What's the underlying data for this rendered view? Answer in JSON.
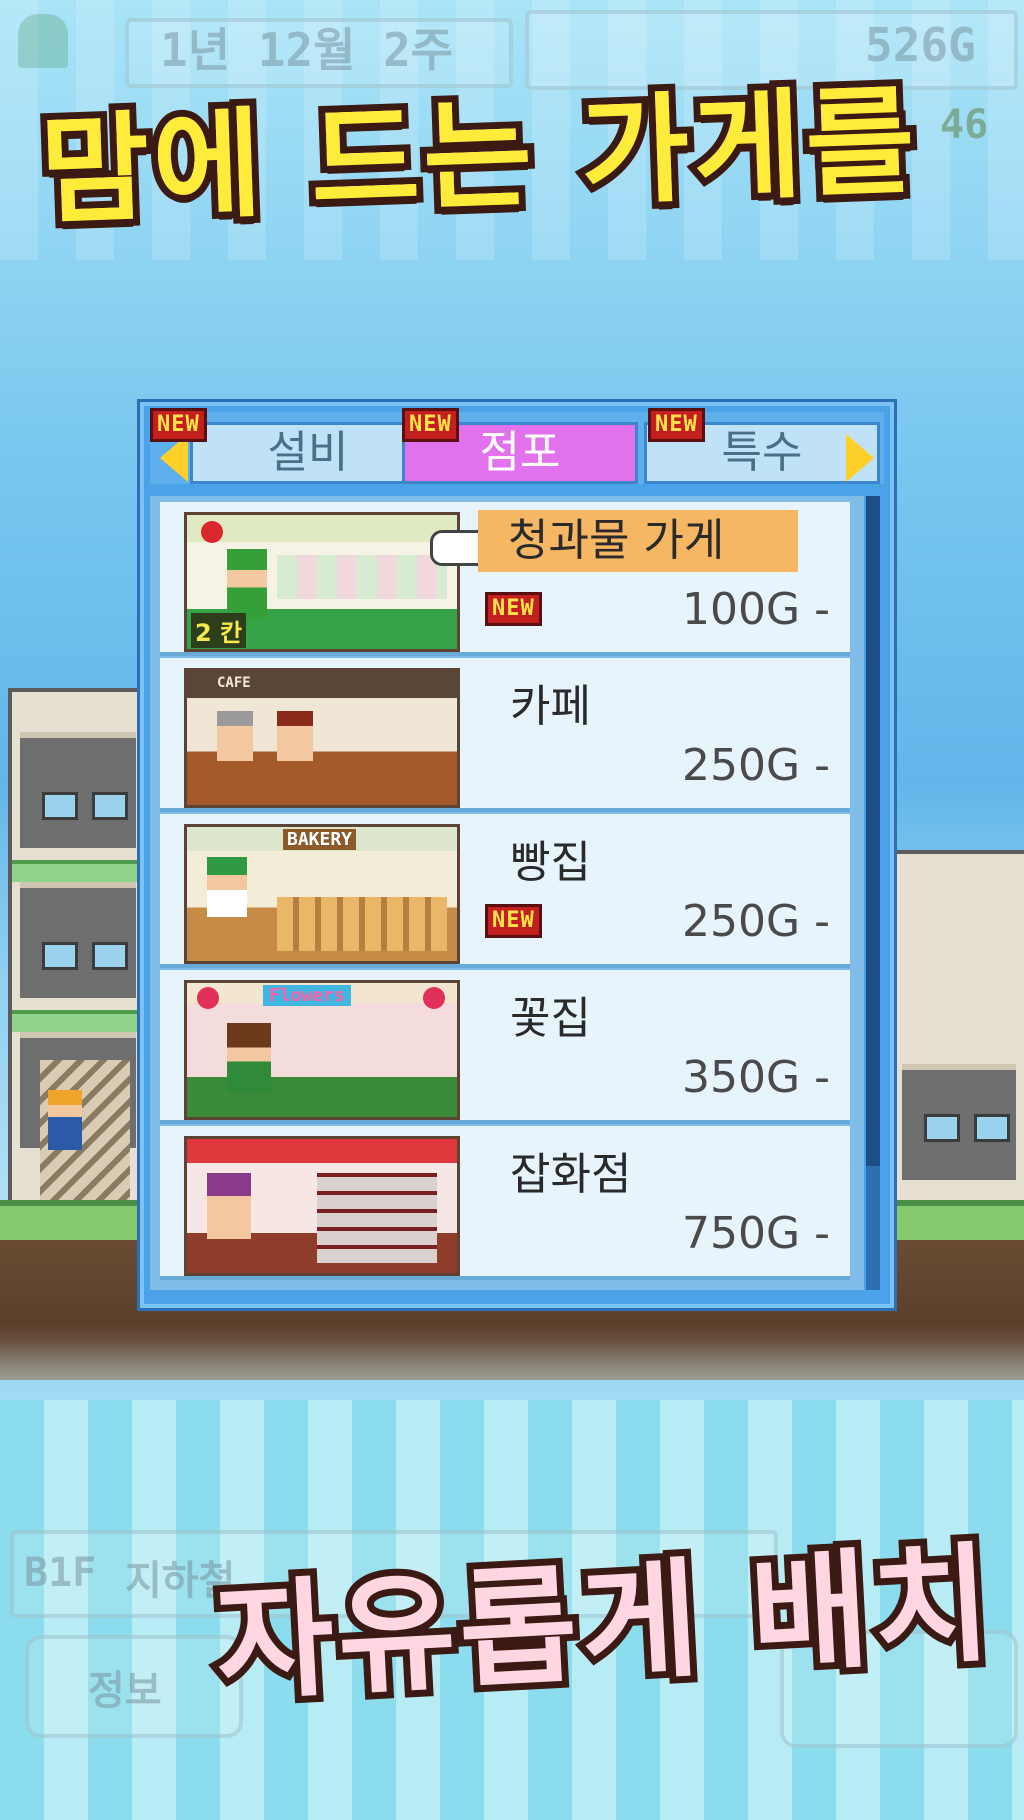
{
  "headline": {
    "top": "맘에 드는 가게를",
    "bottom": "자유롭게 배치"
  },
  "hud": {
    "date": "1년 12월 2주",
    "money": "526G",
    "level": "46",
    "floor": "B1F",
    "floor_name": "지하철",
    "info_button": "정보"
  },
  "tabs": [
    {
      "label": "설비",
      "new": "NEW",
      "active": false
    },
    {
      "label": "점포",
      "new": "NEW",
      "active": true
    },
    {
      "label": "특수",
      "new": "NEW",
      "active": false
    }
  ],
  "shops": [
    {
      "name": "청과물 가게",
      "price": "100G -",
      "new": "NEW",
      "selected": true,
      "badge": "2 칸"
    },
    {
      "name": "카페",
      "price": "250G -",
      "new": "",
      "thumb_text": "CAFE"
    },
    {
      "name": "빵집",
      "price": "250G -",
      "new": "NEW",
      "thumb_text": "BAKERY"
    },
    {
      "name": "꽃집",
      "price": "350G -",
      "new": "",
      "thumb_text": "Flowers"
    },
    {
      "name": "잡화점",
      "price": "750G -",
      "new": ""
    }
  ],
  "colors": {
    "active_tab": "#e271ec",
    "selected_name_bg": "#f5b764",
    "new_tag_bg": "#c41f1f",
    "new_tag_fg": "#ffe34a",
    "headline_top": "#ffec3a",
    "headline_bottom": "#ffd6e2"
  },
  "icons": [
    "tab-left-arrow-icon",
    "tab-right-arrow-icon",
    "pointer-hand-icon"
  ]
}
